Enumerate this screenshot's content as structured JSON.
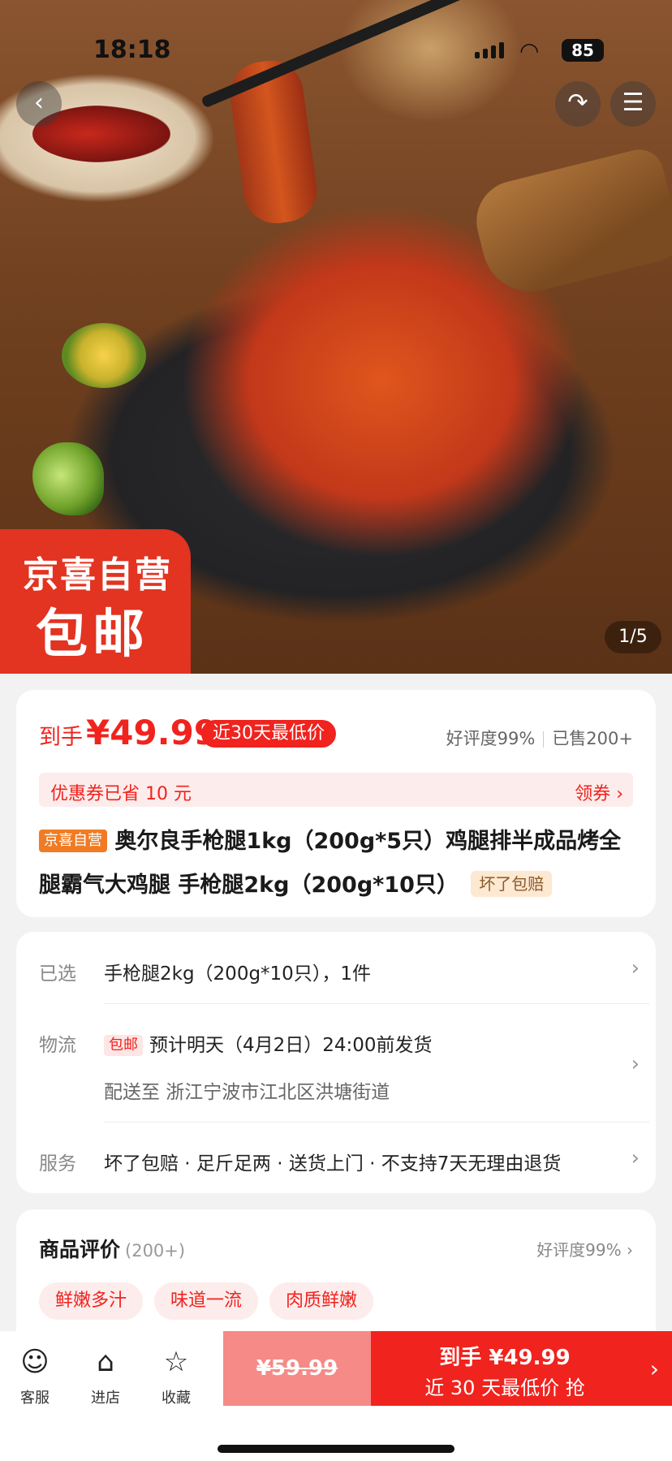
{
  "status_bar": {
    "time": "18:18",
    "battery": "85"
  },
  "gallery": {
    "counter": "1/5",
    "badge_line1": "京喜自营",
    "badge_line2": "包邮"
  },
  "price": {
    "label": "到手",
    "value": "¥49.99",
    "low_tag": "近30天最低价",
    "rating": "好评度99%",
    "sold": "已售200+",
    "coupon_text": "优惠券已省 10 元",
    "coupon_action": "领券 ›"
  },
  "product": {
    "shop_tag": "京喜自营",
    "title": "奥尔良手枪腿1kg（200g*5只）鸡腿排半成品烤全腿霸气大鸡腿 手枪腿2kg（200g*10只）",
    "guarantee_tag": "坏了包赔"
  },
  "options": {
    "selected_label": "已选",
    "selected_value": "手枪腿2kg（200g*10只），1件",
    "logistics_label": "物流",
    "logistics_tag": "包邮",
    "logistics_value": "预计明天（4月2日）24:00前发货",
    "delivery_value": "配送至 浙江宁波市江北区洪塘街道",
    "service_label": "服务",
    "service_value": "坏了包赔 · 足斤足两 · 送货上门 · 不支持7天无理由退货"
  },
  "reviews": {
    "title": "商品评价",
    "count": "(200+)",
    "rating": "好评度99% ›",
    "tags": [
      "鲜嫩多汁",
      "味道一流",
      "肉质鲜嫩"
    ]
  },
  "bottom_bar": {
    "service": "客服",
    "store": "进店",
    "favorite": "收藏",
    "original_price": "¥59.99",
    "buy_line1": "到手 ¥49.99",
    "buy_line2": "近 30 天最低价 抢"
  },
  "colors": {
    "accent": "#f0231e",
    "badge": "#e33321"
  },
  "icons": [
    "back-icon",
    "share-icon",
    "favorites-list-icon",
    "service-icon",
    "store-icon",
    "star-icon",
    "chevron-right-icon"
  ]
}
